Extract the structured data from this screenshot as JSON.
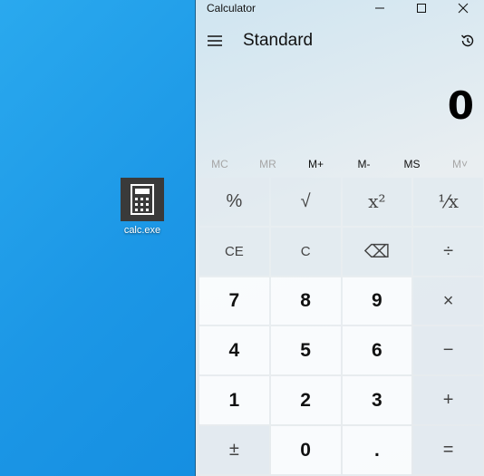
{
  "desktop": {
    "icon_label": "calc.exe"
  },
  "window": {
    "title": "Calculator"
  },
  "header": {
    "mode": "Standard"
  },
  "display": {
    "value": "0"
  },
  "memory": [
    "MC",
    "MR",
    "M+",
    "M-",
    "MS",
    "M˅"
  ],
  "memory_disabled": [
    true,
    true,
    false,
    false,
    false,
    true
  ],
  "keys": [
    [
      "%",
      "√",
      "x²",
      "¹⁄x"
    ],
    [
      "CE",
      "C",
      "⌫",
      "÷"
    ],
    [
      "7",
      "8",
      "9",
      "×"
    ],
    [
      "4",
      "5",
      "6",
      "−"
    ],
    [
      "1",
      "2",
      "3",
      "+"
    ],
    [
      "±",
      "0",
      ".",
      "="
    ]
  ],
  "colors": {
    "desktop": "#1c97e6",
    "icon_tile": "#3a3a3a"
  }
}
